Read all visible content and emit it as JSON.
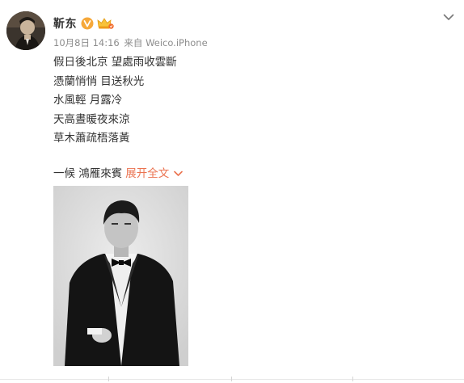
{
  "post": {
    "author": {
      "name": "靳东",
      "avatar_icon": "avatar-photo",
      "badges": [
        "verified-v-icon",
        "vip-member-icon"
      ]
    },
    "time": "10月8日 14:16",
    "source_prefix": "来自",
    "source": "Weico.iPhone",
    "lines": [
      "假日後北京 望處雨收雲斷",
      "憑蘭悄悄 目送秋光",
      "水風輕 月露冷",
      "天高晝暖夜來涼",
      "草木蕭疏梧落黃"
    ],
    "truncated_line": "一候 鴻雁來賓",
    "expand_label": "展开全文",
    "image_alt_icon": "portrait-photo",
    "menu_icon": "chevron-down-icon"
  },
  "colors": {
    "text": "#333333",
    "meta": "#8d8d8d",
    "link_accent": "#eb7350",
    "verified_badge": "#f6a83a",
    "background": "#ffffff"
  }
}
